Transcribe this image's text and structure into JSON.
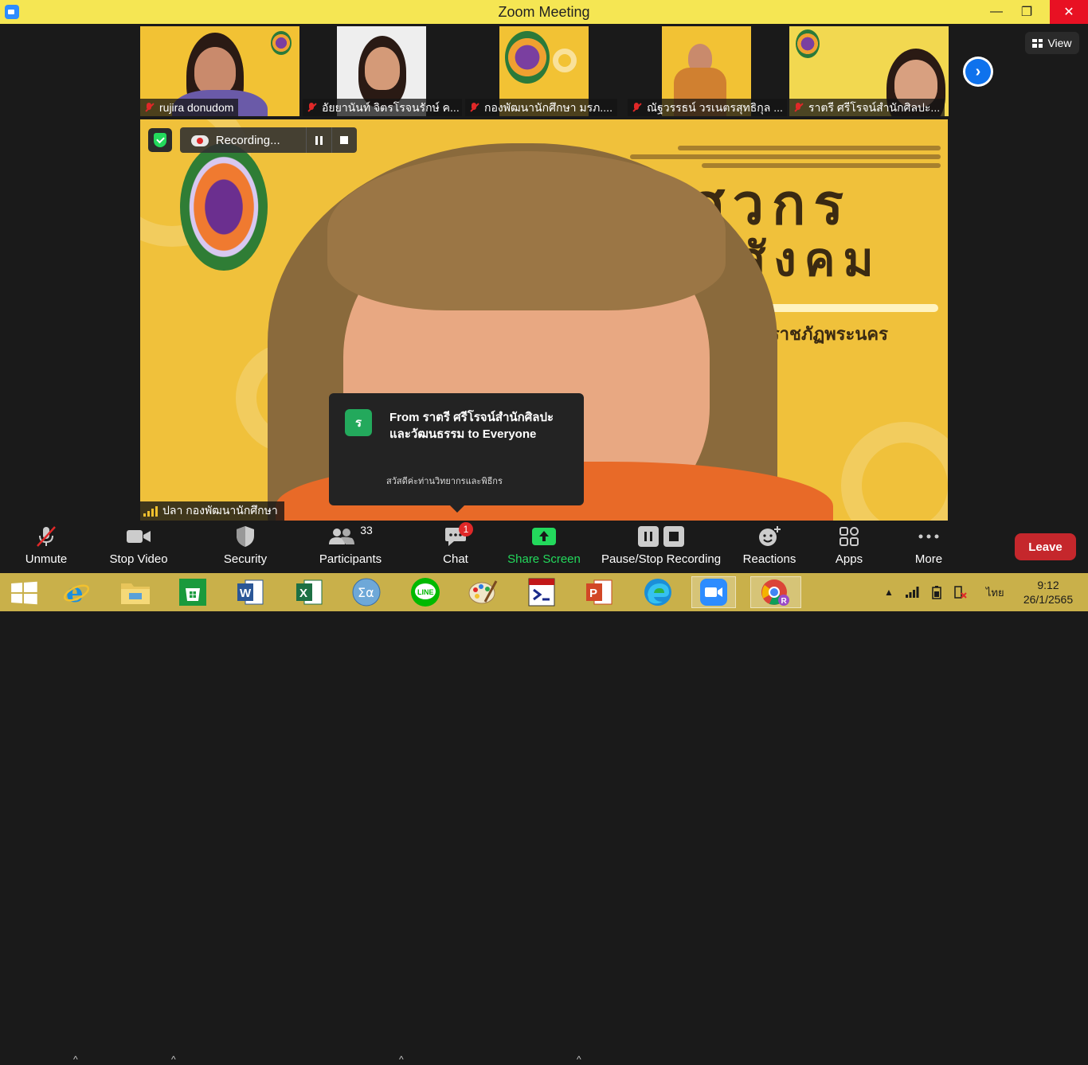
{
  "window": {
    "title": "Zoom Meeting"
  },
  "thumbnails": [
    {
      "name": "rujira donudom",
      "muted": true
    },
    {
      "name": "อัยยานันท์ จิตรโรจนรักษ์ ค...",
      "muted": true
    },
    {
      "name": "กองพัฒนานักศึกษา มรภ....",
      "muted": true
    },
    {
      "name": "ณัฐวรรธน์ วรเนตรสุทธิกุล ...",
      "muted": true
    },
    {
      "name": "ราตรี  ศรีโรจน์สำนักศิลปะ...",
      "muted": true
    }
  ],
  "view_button": {
    "label": "View"
  },
  "recording": {
    "label": "Recording..."
  },
  "main_speaker": {
    "name": "ปลา กองพัฒนานักศึกษา"
  },
  "background_brand": {
    "title_line1": "วิศวกร",
    "title_line2": "สังคม",
    "subtitle": "มหาวิทยาลัยราชภัฏพระนคร"
  },
  "chat_popup": {
    "avatar_letter": "ร",
    "from": "From ราตรี  ศรีโรจน์สำนักศิลปะและวัฒนธรรม to Everyone",
    "message": "สวัสดีค่ะท่านวิทยากรและพิธีกร"
  },
  "toolbar": {
    "unmute": "Unmute",
    "stop_video": "Stop Video",
    "security": "Security",
    "participants": "Participants",
    "participants_count": "33",
    "chat": "Chat",
    "chat_badge": "1",
    "share_screen": "Share Screen",
    "pause_stop_recording": "Pause/Stop Recording",
    "reactions": "Reactions",
    "apps": "Apps",
    "more": "More",
    "leave": "Leave"
  },
  "colors": {
    "title_bar": "#f5e653",
    "share_green": "#23d95c",
    "leave_red": "#c5272c",
    "taskbar": "#c9b04a"
  },
  "taskbar": {
    "lang": "ไทย",
    "time": "9:12",
    "date": "26/1/2565"
  }
}
